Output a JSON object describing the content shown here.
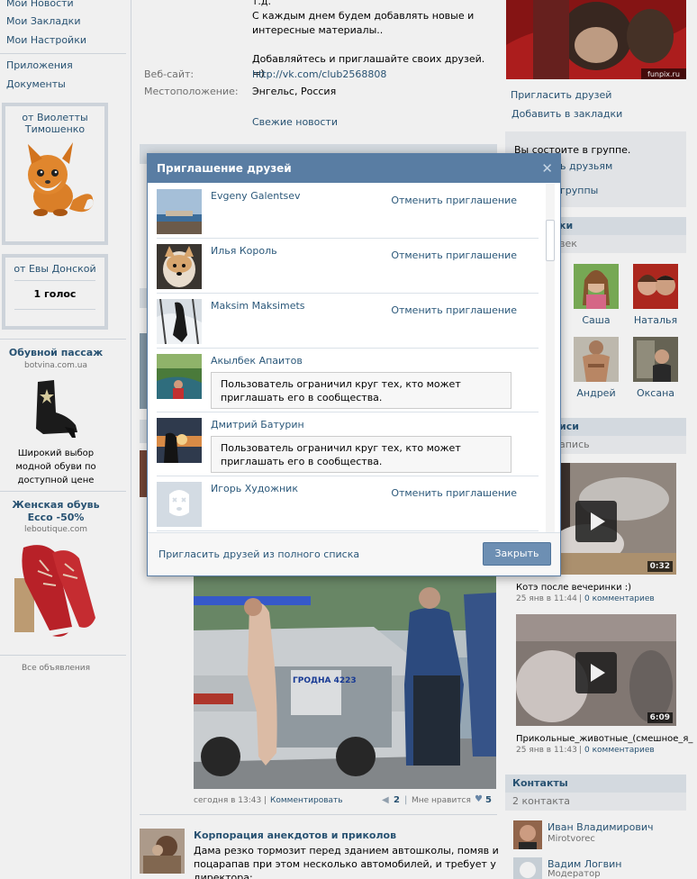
{
  "left_nav": {
    "items": [
      "Мои Новости",
      "Мои Закладки",
      "Мои Настройки",
      "Приложения",
      "Документы"
    ]
  },
  "gifts": [
    {
      "from": "от Виолетты Тимошенко"
    },
    {
      "from": "от Евы Донской",
      "votes": "1 голос"
    }
  ],
  "ads": [
    {
      "title": "Обувной пассаж",
      "host": "botvina.com.ua",
      "text": "Широкий выбор модной обуви по доступной цене"
    },
    {
      "title": "Женская обувь Ecco -50%",
      "host": "leboutique.com"
    }
  ],
  "ads_all": "Все объявления",
  "group_info": {
    "description_lines": [
      "т.д.",
      "С каждым днем будем добавлять новые и",
      "интересные материалы..",
      "",
      "Добавляйтесь и приглашайте своих друзей. =)"
    ],
    "website_label": "Веб-сайт:",
    "website_value": "http://vk.com/club2568808",
    "location_label": "Местоположение:",
    "location_value": "Энгельс, Россия",
    "fresh_news": "Свежие новости"
  },
  "right": {
    "photo_watermark": "funpix.ru",
    "invite_friends": "Пригласить друзей",
    "add_bookmarks": "Добавить в закладки",
    "member_text": "Вы состоите в группе.",
    "partial_link_1": "ь друзьям",
    "partial_link_2": "группы",
    "members_header_partial": "ки",
    "members_sub_partial": "век",
    "friends": [
      {
        "name": "Саша"
      },
      {
        "name": "Наталья"
      },
      {
        "name": "Андрей"
      },
      {
        "name": "Оксана"
      }
    ],
    "videos_header_partial": "иси",
    "videos_sub_partial": "апись",
    "videos": [
      {
        "duration": "0:32",
        "title": "Котэ после вечеринки :)",
        "date": "25 янв в 11:44",
        "comments": "0 комментариев"
      },
      {
        "duration": "6:09",
        "title": "Прикольные_животные_(смешное_я_",
        "date": "25 янв в 11:43",
        "comments": "0 комментариев"
      }
    ],
    "contacts_header": "Контакты",
    "contacts_sub": "2 контакта",
    "contacts": [
      {
        "name": "Иван Владимирович",
        "sub": "Mirotvorec"
      },
      {
        "name": "Вадим Логвин",
        "sub": "Модератор"
      }
    ]
  },
  "post": {
    "time": "сегодня в 13:43",
    "comment": "Комментировать",
    "share_count": "2",
    "like_label": "Мне нравится",
    "like_count": "5"
  },
  "next_post": {
    "author": "Корпорация анекдотов и приколов",
    "text_lines": [
      "Дама резко тормозит перед зданием автошколы, помяв и",
      "поцарапав при этом несколько автомобилей, и требует у",
      "директора:"
    ]
  },
  "modal": {
    "title": "Приглашение друзей",
    "invitees": [
      {
        "name": "Evgeny Galentsev",
        "action": "Отменить приглашение"
      },
      {
        "name": "Илья Король",
        "action": "Отменить приглашение"
      },
      {
        "name": "Maksim Maksimets",
        "action": "Отменить приглашение"
      },
      {
        "name": "Акылбек Апаитов",
        "note": "Пользователь ограничил круг тех, кто может приглашать его в сообщества."
      },
      {
        "name": "Дмитрий Батурин",
        "note": "Пользователь ограничил круг тех, кто может приглашать его в сообщества."
      },
      {
        "name": "Игорь Художник",
        "action": "Отменить приглашение"
      }
    ],
    "full_list_link": "Пригласить друзей из полного списка",
    "close_button": "Закрыть"
  },
  "police_car_text": "ГРОДНА 4223",
  "colors": {
    "link": "#2b587a",
    "modal_header": "#597da3",
    "button": "#6d8fb3",
    "section_header_bg": "#e1e7ed"
  }
}
